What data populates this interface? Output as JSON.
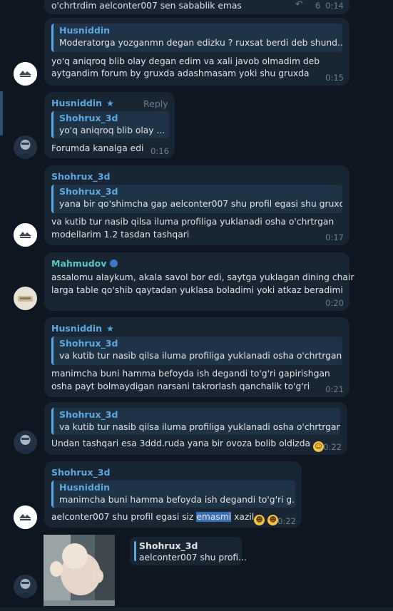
{
  "messages": [
    {
      "text": "o'chrtrdim aelconter007 sen sabablik emas",
      "forward_count": "6",
      "time": "0:14"
    },
    {
      "reply": {
        "name": "Husniddin",
        "text": "Moderatorga yozganmn degan edizku ? ruxsat berdi deb shund..."
      },
      "lines": [
        "yo'q aniqroq blib olay degan edim va xali javob olmadim deb",
        "aytgandim forum by gruxda adashmasam yoki shu gruxda"
      ],
      "time": "0:15"
    },
    {
      "sender": "Husniddin",
      "reply_label": "Reply",
      "reply": {
        "name": "Shohrux_3d",
        "text": "yo'q aniqroq blib olay ..."
      },
      "lines": [
        "Forumda  kanalga edi"
      ],
      "time": "0:16"
    },
    {
      "sender": "Shohrux_3d",
      "reply": {
        "name": "Shohrux_3d",
        "text": "yana bir qo'shimcha gap aelconter007 shu profil egasi shu gruxd..."
      },
      "lines": [
        "va kutib tur nasib qilsa iluma profiliga yuklanadi osha o'chrtrgan",
        "modellarim 1.2 tasdan tashqari"
      ],
      "time": "0:17"
    },
    {
      "sender": "Mahmudov",
      "lines": [
        "assalomu alaykum, akala savol bor edi, saytga yuklagan dining chair",
        "larga table qo'shib qaytadan yuklasa boladimi yoki atkaz beradimi"
      ],
      "time": "0:20"
    },
    {
      "sender": "Husniddin",
      "reply": {
        "name": "Shohrux_3d",
        "text": "va kutib tur nasib qilsa iluma profiliga yuklanadi osha o'chrtrgan..."
      },
      "lines": [
        "manimcha buni hamma befoyda ish degandi to'g'ri gapirishgan",
        "osha payt bolmaydigan narsani takrorlash  qanchalik to'g'ri"
      ],
      "time": "0:21"
    },
    {
      "reply": {
        "name": "Shohrux_3d",
        "text": "va kutib tur nasib qilsa iluma profiliga yuklanadi osha o'chrtrgan..."
      },
      "lines": [
        "Undan tashqari esa 3ddd.ruda yana bir ovoza bolib oldizda"
      ],
      "time": "0:22"
    },
    {
      "sender": "Shohrux_3d",
      "reply": {
        "name": "Husniddin",
        "text": "manimcha buni hamma befoyda ish degandi to'g'ri g..."
      },
      "line_before": "aelconter007 shu profil egasi siz ",
      "line_highlight": "emasmi",
      "line_after": " xazil",
      "time": "0:22"
    },
    {
      "reply": {
        "name": "Shohrux_3d",
        "text": "aelconter007 shu profi..."
      }
    }
  ],
  "icons": {
    "forward": "forward-arrow-icon",
    "admin_star": "star-icon",
    "verified": "verified-badge-icon",
    "emoji_smile": "smiling-face-emoji",
    "emoji_laugh": "tears-of-joy-emoji"
  },
  "colors": {
    "background": "#0e1621",
    "bubble": "#182533",
    "quote_bg": "#1f3347",
    "accent_blue": "#5ca8e0",
    "accent_teal": "#59c7c4",
    "time": "#6d7f8f"
  }
}
